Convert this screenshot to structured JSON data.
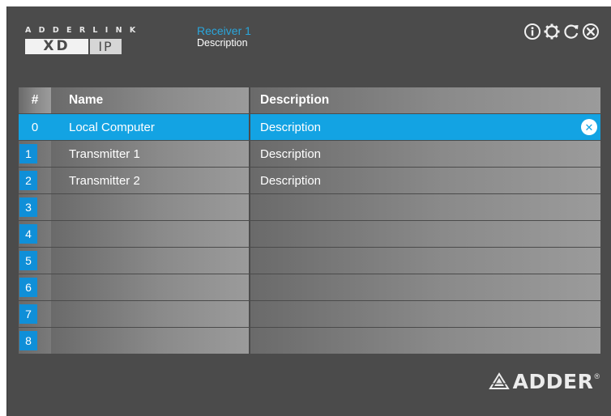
{
  "brand": {
    "wordmark": "ADDERLINK",
    "logo_main": "XD",
    "logo_ip": "IP"
  },
  "device": {
    "name": "Receiver 1",
    "description": "Description"
  },
  "toolbar": {
    "icons": [
      "info-icon",
      "settings-icon",
      "refresh-icon",
      "close-icon"
    ]
  },
  "table": {
    "headers": {
      "num": "#",
      "name": "Name",
      "description": "Description"
    },
    "rows": [
      {
        "num": "0",
        "name": "Local Computer",
        "description": "Description",
        "selected": true
      },
      {
        "num": "1",
        "name": "Transmitter 1",
        "description": "Description"
      },
      {
        "num": "2",
        "name": "Transmitter 2",
        "description": "Description"
      },
      {
        "num": "3",
        "name": "",
        "description": ""
      },
      {
        "num": "4",
        "name": "",
        "description": ""
      },
      {
        "num": "5",
        "name": "",
        "description": ""
      },
      {
        "num": "6",
        "name": "",
        "description": ""
      },
      {
        "num": "7",
        "name": "",
        "description": ""
      },
      {
        "num": "8",
        "name": "",
        "description": ""
      }
    ],
    "clear_icon": "close-circle-icon"
  },
  "footer": {
    "logo_text": "ADDER",
    "registered": "®"
  },
  "colors": {
    "accent": "#13a3e3",
    "badge": "#0f8fd8",
    "background": "#4b4b4b",
    "device_name": "#2aa6dc"
  }
}
